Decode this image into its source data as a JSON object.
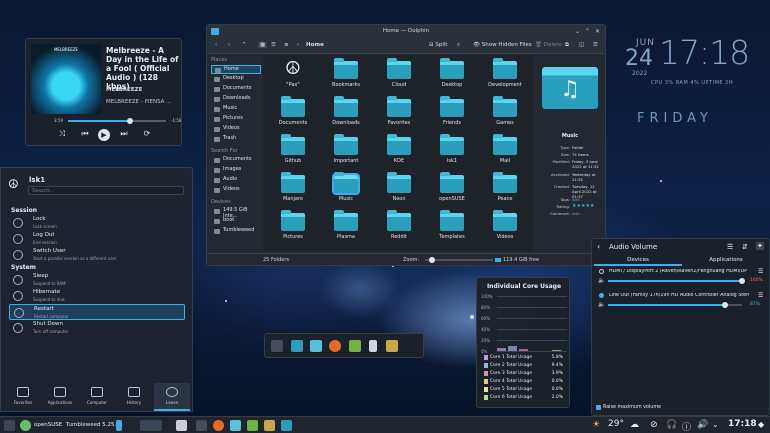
{
  "media": {
    "art_text": "MELBREEZE",
    "title": "Melbreeze - A Day in the Life of a Fool ( Official Audio ) (128 kbps)",
    "artist": "MELBREEZE",
    "album": "MELBREEZE - PIENSA ...",
    "elapsed": "3:59",
    "remaining": "-1:58",
    "progress": 0.63,
    "icons": [
      "shuffle-icon",
      "previous-icon",
      "play-icon",
      "next-icon",
      "repeat-icon"
    ]
  },
  "launcher": {
    "user": "lsk1",
    "search_placeholder": "Search...",
    "session_heading": "Session",
    "system_heading": "System",
    "items": [
      {
        "title": "Lock",
        "sub": "Lock screen"
      },
      {
        "title": "Log Out",
        "sub": "End session"
      },
      {
        "title": "Switch User",
        "sub": "Start a parallel session as a different user"
      },
      {
        "title": "Sleep",
        "sub": "Suspend to RAM"
      },
      {
        "title": "Hibernate",
        "sub": "Suspend to disk"
      },
      {
        "title": "Restart",
        "sub": "Restart computer"
      },
      {
        "title": "Shut Down",
        "sub": "Turn off computer"
      }
    ],
    "tabs": [
      "Favorites",
      "Applications",
      "Computer",
      "History",
      "Leave"
    ]
  },
  "dolphin": {
    "title": "Home — Dolphin",
    "breadcrumb": "Home",
    "split": "Split",
    "show_hidden": "Show Hidden Files",
    "delete": "Delete",
    "places_heading": "Places",
    "places": [
      "Home",
      "Desktop",
      "Documents",
      "Downloads",
      "Music",
      "Pictures",
      "Videos",
      "Trash"
    ],
    "search_heading": "Search For",
    "search_items": [
      "Documents",
      "Images",
      "Audio",
      "Videos"
    ],
    "devices_heading": "Devices",
    "devices": [
      "149.5 GiB Inte...",
      "boot",
      "Tumbleweed"
    ],
    "files": [
      "\"Pax\"",
      "Bookmarks",
      "Cloud",
      "Desktop",
      "Development",
      "Documents",
      "Downloads",
      "Favorites",
      "Friends",
      "Games",
      "Github",
      "Important",
      "KDE",
      "lsk1",
      "Mail",
      "Manjaro",
      "Music",
      "Neon",
      "openSUSE",
      "Peace",
      "Pictures",
      "Plasma",
      "Reddit",
      "Templates",
      "Videos"
    ],
    "selected_file": "Music",
    "info": {
      "name": "Music",
      "rows": [
        {
          "k": "Type:",
          "v": "Folder"
        },
        {
          "k": "Size:",
          "v": "74 items"
        },
        {
          "k": "Modified:",
          "v": "Friday, 3 June 2022 at 11:31"
        },
        {
          "k": "Accessed:",
          "v": "Yesterday at 21:32"
        },
        {
          "k": "Created:",
          "v": "Tuesday, 12 April 2022 at 01:37"
        },
        {
          "k": "Tags:",
          "v": "Add..."
        },
        {
          "k": "Rating:",
          "v": ""
        },
        {
          "k": "Comment:",
          "v": "Add..."
        }
      ],
      "rating": 5
    },
    "status_left": "25 Folders",
    "zoom_label": "Zoom:",
    "free": "119.4 GiB free"
  },
  "clock": {
    "month": "JUN",
    "day": "24",
    "time": "17:18",
    "year": "2022",
    "stats": "CPU 3% RAM 4% UPTIME 2H",
    "weekday": "FRIDAY"
  },
  "cpu": {
    "title": "Individual Core Usage",
    "yticks": [
      "100%",
      "80%",
      "60%",
      "40%",
      "20%",
      "0%"
    ],
    "cores": [
      {
        "name": "Core 1 Total Usage",
        "value": "5.8%",
        "color": "#c79ae0"
      },
      {
        "name": "Core 2 Total Usage",
        "value": "9.4%",
        "color": "#9fb0e0"
      },
      {
        "name": "Core 3 Total Usage",
        "value": "3.9%",
        "color": "#e08fb3"
      },
      {
        "name": "Core 4 Total Usage",
        "value": "0.0%",
        "color": "#f0c38a"
      },
      {
        "name": "Core 5 Total Usage",
        "value": "0.0%",
        "color": "#f5e08a"
      },
      {
        "name": "Core 6 Total Usage",
        "value": "2.0%",
        "color": "#b5e08a"
      }
    ]
  },
  "volume": {
    "title": "Audio Volume",
    "tabs": [
      "Devices",
      "Applications"
    ],
    "devices": [
      {
        "name": "HDMI / DisplayPort 2 (Raven/Raven2/Fenghuang HDMI/DP ...",
        "level": 1.0,
        "pct": "100%"
      },
      {
        "name": "Line Out (Family 17h/19h HD Audio Controller Analog Stereo)",
        "level": 0.87,
        "pct": "87%"
      }
    ],
    "raise_max": "Raise maximum volume"
  },
  "taskbar": {
    "distro": "openSUSE",
    "version": "Tumbleweed 5.25.1",
    "temp": "29°",
    "time": "17:18"
  },
  "colors": {
    "accent": "#3daee9",
    "folder": "#2a9fbd"
  }
}
